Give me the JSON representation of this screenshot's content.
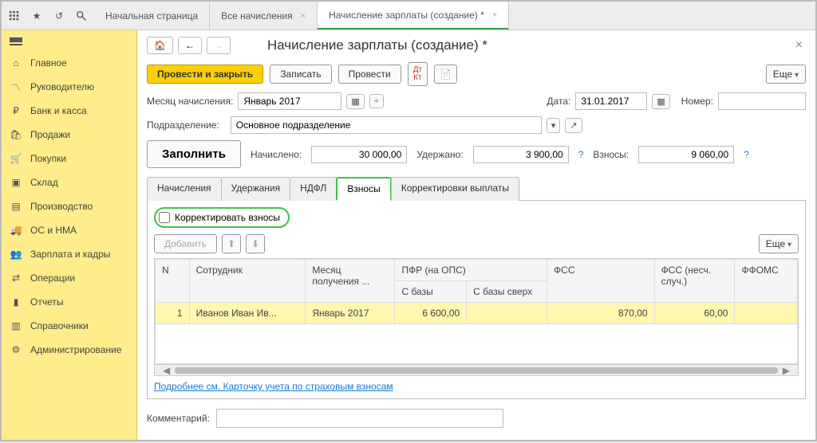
{
  "appTabs": [
    {
      "label": "Начальная страница",
      "active": false,
      "closable": false
    },
    {
      "label": "Все начисления",
      "active": false,
      "closable": true
    },
    {
      "label": "Начисление зарплаты (создание) *",
      "active": true,
      "closable": true
    }
  ],
  "sidebar": {
    "items": [
      {
        "label": "Главное"
      },
      {
        "label": "Руководителю"
      },
      {
        "label": "Банк и касса"
      },
      {
        "label": "Продажи"
      },
      {
        "label": "Покупки"
      },
      {
        "label": "Склад"
      },
      {
        "label": "Производство"
      },
      {
        "label": "ОС и НМА"
      },
      {
        "label": "Зарплата и кадры"
      },
      {
        "label": "Операции"
      },
      {
        "label": "Отчеты"
      },
      {
        "label": "Справочники"
      },
      {
        "label": "Администрирование"
      }
    ]
  },
  "page": {
    "title": "Начисление зарплаты (создание) *",
    "buttons": {
      "postAndClose": "Провести и закрыть",
      "write": "Записать",
      "post": "Провести",
      "more": "Еще"
    },
    "monthLabel": "Месяц начисления:",
    "monthValue": "Январь 2017",
    "dateLabel": "Дата:",
    "dateValue": "31.01.2017",
    "numberLabel": "Номер:",
    "numberValue": "",
    "departmentLabel": "Подразделение:",
    "departmentValue": "Основное подразделение",
    "fillButton": "Заполнить",
    "accruedLabel": "Начислено:",
    "accruedValue": "30 000,00",
    "withheldLabel": "Удержано:",
    "withheldValue": "3 900,00",
    "contribLabel": "Взносы:",
    "contribValue": "9 060,00",
    "tabs": [
      {
        "label": "Начисления"
      },
      {
        "label": "Удержания"
      },
      {
        "label": "НДФЛ"
      },
      {
        "label": "Взносы",
        "active": true
      },
      {
        "label": "Корректировки выплаты"
      }
    ],
    "correctCheckbox": "Корректировать взносы",
    "addButton": "Добавить",
    "tableMore": "Еще",
    "columns": {
      "n": "N",
      "employee": "Сотрудник",
      "month": "Месяц получения ...",
      "pfr": "ПФР (на ОПС)",
      "pfr_base": "С базы",
      "pfr_over": "С базы сверх",
      "fss": "ФСС",
      "fss_acc": "ФСС (несч. случ.)",
      "ffoms": "ФФОМС"
    },
    "rows": [
      {
        "n": "1",
        "employee": "Иванов Иван Ив...",
        "month": "Январь 2017",
        "pfr_base": "6 600,00",
        "pfr_over": "",
        "fss": "870,00",
        "fss_acc": "60,00",
        "ffoms": ""
      }
    ],
    "footerLink": "Подробнее см. Карточку учета по страховым взносам",
    "commentLabel": "Комментарий:",
    "commentValue": ""
  }
}
